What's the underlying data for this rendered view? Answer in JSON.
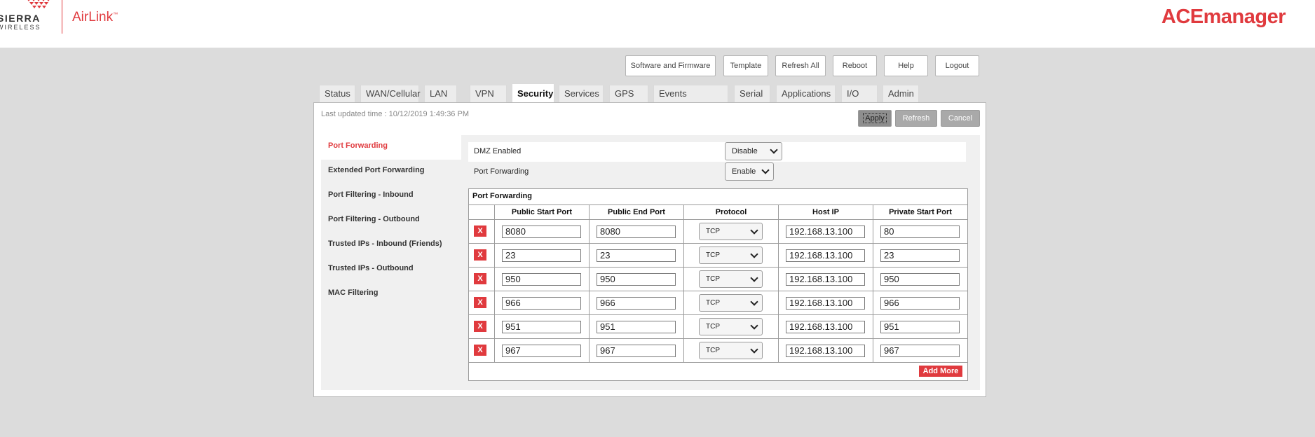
{
  "header": {
    "brand_sierra": "SIERRA",
    "brand_wireless": "WIRELESS",
    "brand_airlink": "AirLink",
    "app_title": "ACEmanager"
  },
  "top_buttons": [
    "Software and Firmware",
    "Template",
    "Refresh All",
    "Reboot",
    "Help",
    "Logout"
  ],
  "tabs": [
    "Status",
    "WAN/Cellular",
    "LAN",
    "VPN",
    "Security",
    "Services",
    "GPS",
    "Events Reporting",
    "Serial",
    "Applications",
    "I/O",
    "Admin"
  ],
  "active_tab": "Security",
  "panel": {
    "last_updated": "Last updated time : 10/12/2019 1:49:36 PM",
    "apply": "Apply",
    "refresh": "Refresh",
    "cancel": "Cancel"
  },
  "leftnav": [
    "Port Forwarding",
    "Extended Port Forwarding",
    "Port Filtering - Inbound",
    "Port Filtering - Outbound",
    "Trusted IPs - Inbound (Friends)",
    "Trusted IPs - Outbound",
    "MAC Filtering"
  ],
  "active_nav": "Port Forwarding",
  "settings": {
    "dmz_label": "DMZ Enabled",
    "dmz_value": "Disable",
    "pf_label": "Port Forwarding",
    "pf_value": "Enable"
  },
  "table": {
    "title": "Port Forwarding",
    "headers": [
      "Public Start Port",
      "Public End Port",
      "Protocol",
      "Host IP",
      "Private Start Port"
    ],
    "delete_label": "X",
    "add_more": "Add More",
    "rows": [
      {
        "start": "8080",
        "end": "8080",
        "protocol": "TCP",
        "host": "192.168.13.100",
        "private": "80"
      },
      {
        "start": "23",
        "end": "23",
        "protocol": "TCP",
        "host": "192.168.13.100",
        "private": "23"
      },
      {
        "start": "950",
        "end": "950",
        "protocol": "TCP",
        "host": "192.168.13.100",
        "private": "950"
      },
      {
        "start": "966",
        "end": "966",
        "protocol": "TCP",
        "host": "192.168.13.100",
        "private": "966"
      },
      {
        "start": "951",
        "end": "951",
        "protocol": "TCP",
        "host": "192.168.13.100",
        "private": "951"
      },
      {
        "start": "967",
        "end": "967",
        "protocol": "TCP",
        "host": "192.168.13.100",
        "private": "967"
      }
    ]
  },
  "colors": {
    "accent": "#e03a3e",
    "background": "#dcdcdc"
  }
}
